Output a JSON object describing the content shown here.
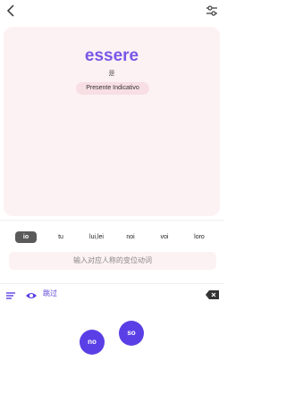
{
  "card": {
    "verb": "essere",
    "meaning": "是",
    "tense": "Presente Indicativo"
  },
  "pronouns": [
    "io",
    "tu",
    "lui,lei",
    "noi",
    "voi",
    "loro"
  ],
  "answer": {
    "placeholder": "输入对应人称的变位动词"
  },
  "toolbar": {
    "skip_label": "跳过"
  },
  "bubbles": [
    "no",
    "so"
  ],
  "colors": {
    "accent": "#5b3fe6",
    "verb": "#7a55e8",
    "card_bg": "#fdf2f3",
    "active_tab": "#5a5a5a"
  },
  "icons": {
    "back": "chevron-left-icon",
    "filter": "sliders-icon",
    "menu": "list-icon",
    "eye": "eye-icon",
    "backspace": "backspace-icon"
  }
}
